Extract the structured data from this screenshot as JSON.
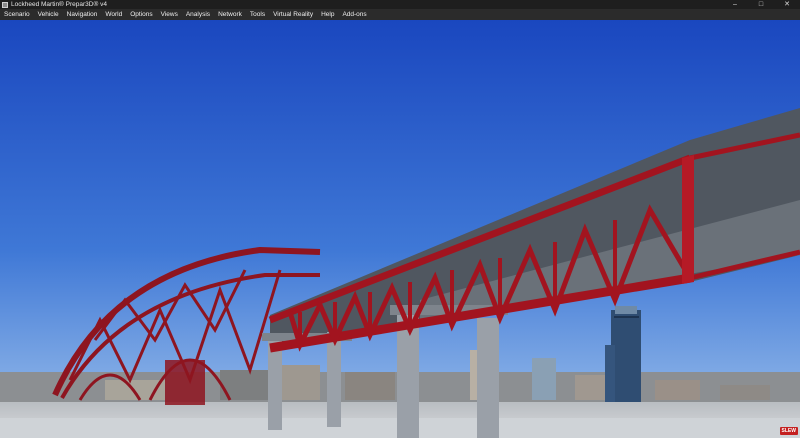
{
  "window": {
    "title": "Lockheed Martin® Prepar3D® v4",
    "minimize_glyph": "–",
    "maximize_glyph": "□",
    "close_glyph": "✕"
  },
  "menu": {
    "items": [
      "Scenario",
      "Vehicle",
      "Navigation",
      "World",
      "Options",
      "Views",
      "Analysis",
      "Network",
      "Tools",
      "Virtual Reality",
      "Help",
      "Add-ons"
    ]
  },
  "status": {
    "slew_label": "SLEW"
  },
  "colors": {
    "sky_top": "#1a4fc4",
    "sky_bottom": "#8fb6e8",
    "truss": "#9a1822",
    "deck": "#5a6068",
    "piers": "#9aa0a8"
  }
}
